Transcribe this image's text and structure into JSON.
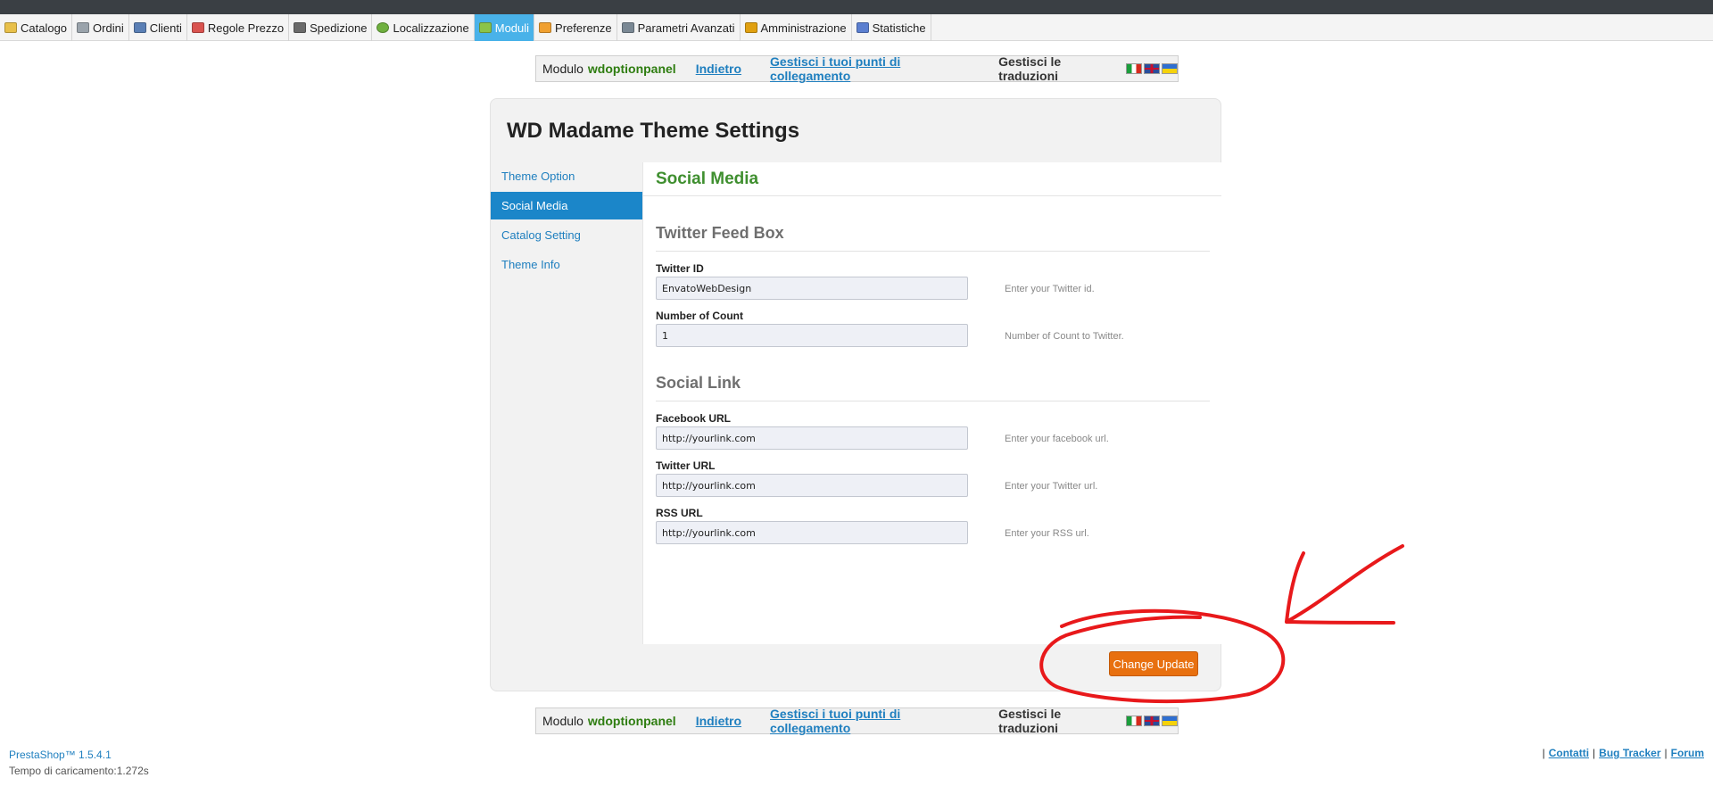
{
  "menu": [
    {
      "label": "Catalogo",
      "icon": "folder-icon",
      "color": "#e8c04a",
      "active": false
    },
    {
      "label": "Ordini",
      "icon": "cart-icon",
      "color": "#9aa3ab",
      "active": false
    },
    {
      "label": "Clienti",
      "icon": "user-icon",
      "color": "#5a7fb5",
      "active": false
    },
    {
      "label": "Regole Prezzo",
      "icon": "price-tag-icon",
      "color": "#d9534f",
      "active": false
    },
    {
      "label": "Spedizione",
      "icon": "truck-icon",
      "color": "#6a6a6a",
      "active": false
    },
    {
      "label": "Localizzazione",
      "icon": "globe-icon",
      "color": "#6fb03f",
      "active": false
    },
    {
      "label": "Moduli",
      "icon": "puzzle-icon",
      "color": "#8bc34a",
      "active": true
    },
    {
      "label": "Preferenze",
      "icon": "preferences-icon",
      "color": "#f0a030",
      "active": false
    },
    {
      "label": "Parametri Avanzati",
      "icon": "wrench-icon",
      "color": "#7a8894",
      "active": false
    },
    {
      "label": "Amministrazione",
      "icon": "key-icon",
      "color": "#e0a010",
      "active": false
    },
    {
      "label": "Statistiche",
      "icon": "bar-chart-icon",
      "color": "#5b7fd0",
      "active": false
    }
  ],
  "module_bar": {
    "label": "Modulo",
    "module_name": "wdoptionpanel",
    "back_link": "Indietro",
    "hooks_link": "Gestisci i tuoi punti di collegamento",
    "translations_label": "Gestisci le traduzioni",
    "flags": [
      "italian-flag-icon",
      "english-flag-icon",
      "ukrainian-flag-icon"
    ]
  },
  "panel": {
    "title": "WD Madame Theme Settings",
    "nav": [
      {
        "label": "Theme Option",
        "active": false
      },
      {
        "label": "Social Media",
        "active": true
      },
      {
        "label": "Catalog Setting",
        "active": false
      },
      {
        "label": "Theme Info",
        "active": false
      }
    ],
    "content_title": "Social Media",
    "sections": [
      {
        "title": "Twitter Feed Box",
        "fields": [
          {
            "label": "Twitter ID",
            "value": "EnvatoWebDesign",
            "hint": "Enter your Twitter id."
          },
          {
            "label": "Number of Count",
            "value": "1",
            "hint": "Number of Count to Twitter."
          }
        ]
      },
      {
        "title": "Social Link",
        "fields": [
          {
            "label": "Facebook URL",
            "value": "http://yourlink.com",
            "hint": "Enter your facebook url."
          },
          {
            "label": "Twitter URL",
            "value": "http://yourlink.com",
            "hint": "Enter your Twitter url."
          },
          {
            "label": "RSS URL",
            "value": "http://yourlink.com",
            "hint": "Enter your RSS url."
          }
        ]
      }
    ],
    "submit_label": "Change Update"
  },
  "footer": {
    "version": "PrestaShop™ 1.5.4.1",
    "load_time": "Tempo di caricamento:1.272s",
    "separator": "|",
    "links": [
      "Contatti",
      "Bug Tracker",
      "Forum"
    ]
  },
  "colors": {
    "active_menu": "#49b2e9",
    "active_nav": "#1b86c9",
    "section_green": "#3f8f2f",
    "button_orange": "#e8700f",
    "annotation_red": "#e8191b"
  }
}
